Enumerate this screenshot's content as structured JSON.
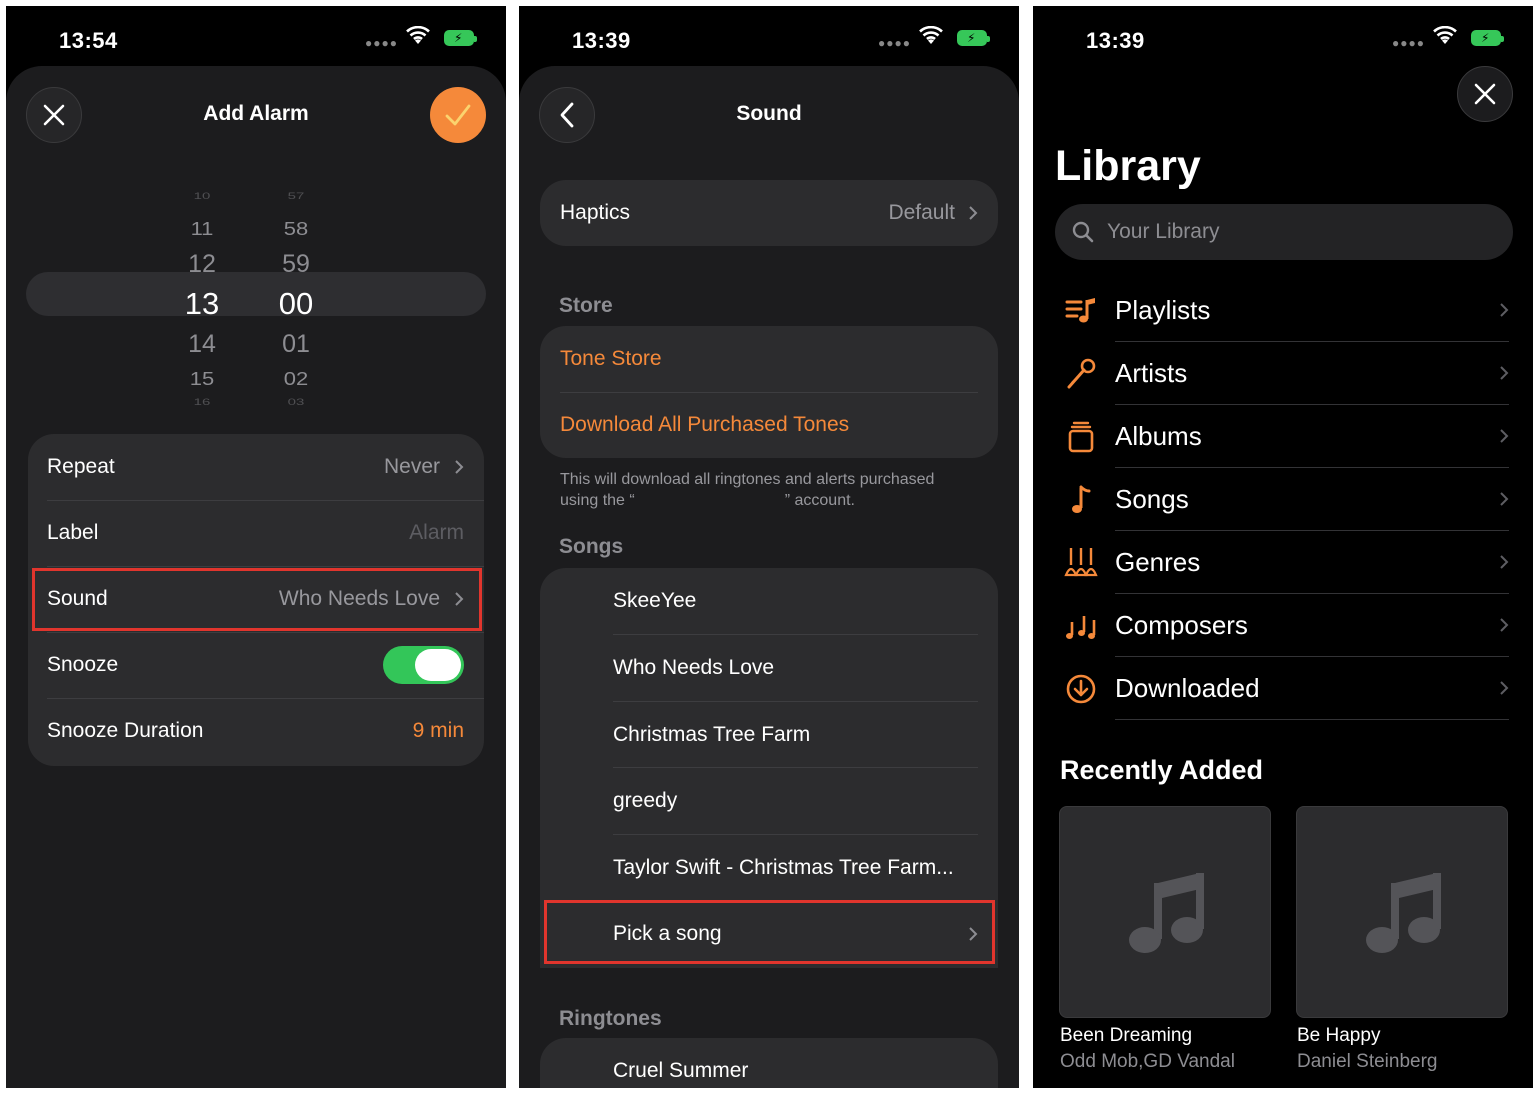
{
  "screen1": {
    "time": "13:54",
    "title": "Add Alarm",
    "hours": [
      "10",
      "11",
      "12",
      "13",
      "14",
      "15",
      "16"
    ],
    "minutes": [
      "57",
      "58",
      "59",
      "00",
      "01",
      "02",
      "03"
    ],
    "rows": {
      "repeat": {
        "label": "Repeat",
        "value": "Never"
      },
      "label": {
        "label": "Label",
        "value": "Alarm"
      },
      "sound": {
        "label": "Sound",
        "value": "Who Needs Love"
      },
      "snooze": {
        "label": "Snooze",
        "on": true
      },
      "snooze_duration": {
        "label": "Snooze Duration",
        "value": "9 min"
      }
    }
  },
  "screen2": {
    "time": "13:39",
    "title": "Sound",
    "haptics": {
      "label": "Haptics",
      "value": "Default"
    },
    "store_header": "Store",
    "tone_store": "Tone Store",
    "download_all": "Download All Purchased Tones",
    "footnote_line1": "This will download all ringtones and alerts purchased",
    "footnote_line2a": "using the “",
    "footnote_line2b": "” account.",
    "songs_header": "Songs",
    "songs": [
      "SkeeYee",
      "Who Needs Love",
      "Christmas Tree Farm",
      "greedy",
      "Taylor Swift - Christmas Tree Farm..."
    ],
    "pick_song": "Pick a song",
    "ringtones_header": "Ringtones",
    "ringtones": [
      "Cruel Summer"
    ]
  },
  "screen3": {
    "time": "13:39",
    "title": "Library",
    "search_placeholder": "Your Library",
    "items": [
      {
        "label": "Playlists",
        "icon": "playlists-icon"
      },
      {
        "label": "Artists",
        "icon": "microphone-icon"
      },
      {
        "label": "Albums",
        "icon": "album-stack-icon"
      },
      {
        "label": "Songs",
        "icon": "music-note-icon"
      },
      {
        "label": "Genres",
        "icon": "guitars-icon"
      },
      {
        "label": "Composers",
        "icon": "notes-icon"
      },
      {
        "label": "Downloaded",
        "icon": "download-circle-icon"
      }
    ],
    "recently_added_header": "Recently Added",
    "albums": [
      {
        "title": "Been Dreaming",
        "artist": "Odd Mob,GD Vandal"
      },
      {
        "title": "Be Happy",
        "artist": "Daniel Steinberg"
      }
    ]
  },
  "colors": {
    "accent": "#f5893a",
    "toggle_on": "#33c659",
    "highlight_box": "#e1352d",
    "battery": "#36c759"
  }
}
